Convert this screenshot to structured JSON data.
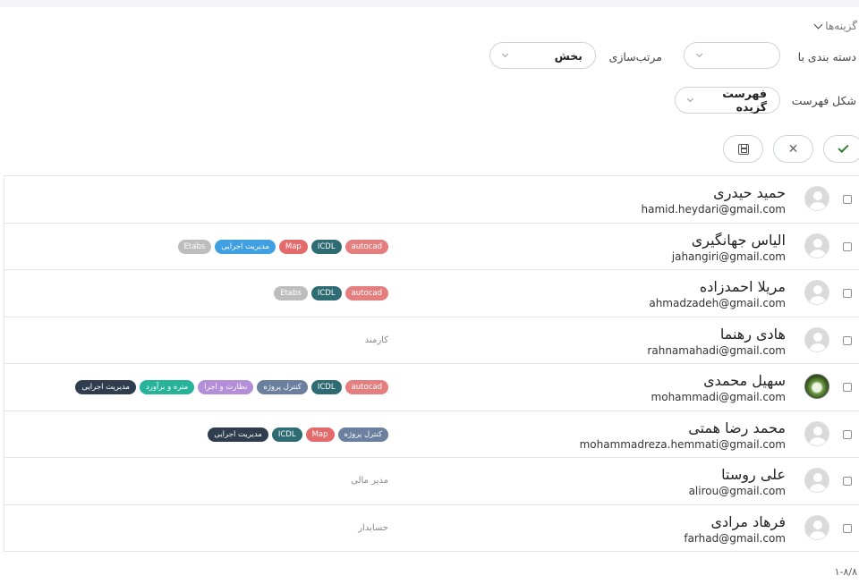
{
  "options": {
    "label": "گزینه‌ها"
  },
  "controls": {
    "group_by": {
      "label": "دسته بندی با",
      "value": ""
    },
    "sort": {
      "label": "مرتب‌سازی",
      "value": "بخش"
    },
    "list_style": {
      "label": "شکل فهرست",
      "value": "فهرست گزیده"
    }
  },
  "actions": {
    "confirm_icon": "check-icon",
    "cancel_icon": "close-icon",
    "save_icon": "save-icon"
  },
  "colors": {
    "autocad": "#e57f7f",
    "ICDL": "#2e6b73",
    "Map": "#e46b6b",
    "project": "#6b7f9e",
    "supervision": "#b48ed8",
    "metering": "#26b39a",
    "executive_dark": "#2f3d4f",
    "executive_blue": "#3f9fe0",
    "Etabs": "#bdbdbd"
  },
  "users": [
    {
      "name": "حمید حیدری",
      "email": "hamid.heydari@gmail.com",
      "photo": false,
      "role": "",
      "tags": []
    },
    {
      "name": "الیاس جهانگیری",
      "email": "jahangiri@gmail.com",
      "photo": false,
      "role": "",
      "tags": [
        {
          "label": "autocad",
          "color": "#e57f7f"
        },
        {
          "label": "ICDL",
          "color": "#2e6b73"
        },
        {
          "label": "Map",
          "color": "#e46b6b"
        },
        {
          "label": "مدیریت اجرایی",
          "color": "#3f9fe0"
        },
        {
          "label": "Etabs",
          "color": "#bdbdbd"
        }
      ]
    },
    {
      "name": "مریلا احمدزاده",
      "email": "ahmadzadeh@gmail.com",
      "photo": false,
      "role": "",
      "tags": [
        {
          "label": "autocad",
          "color": "#e57f7f"
        },
        {
          "label": "ICDL",
          "color": "#2e6b73"
        },
        {
          "label": "Etabs",
          "color": "#bdbdbd"
        }
      ]
    },
    {
      "name": "هادی رهنما",
      "email": "rahnamahadi@gmail.com",
      "photo": false,
      "role": "کارمند",
      "tags": []
    },
    {
      "name": "سهیل محمدی",
      "email": "mohammadi@gmail.com",
      "photo": true,
      "role": "",
      "tags": [
        {
          "label": "autocad",
          "color": "#e57f7f"
        },
        {
          "label": "ICDL",
          "color": "#2e6b73"
        },
        {
          "label": "کنترل پروژه",
          "color": "#6b7f9e"
        },
        {
          "label": "نظارت و اجرا",
          "color": "#b48ed8"
        },
        {
          "label": "متره و برآورد",
          "color": "#26b39a"
        },
        {
          "label": "مدیریت اجرایی",
          "color": "#2f3d4f"
        }
      ]
    },
    {
      "name": "محمد رضا همتی",
      "email": "mohammadreza.hemmati@gmail.com",
      "photo": false,
      "role": "",
      "tags": [
        {
          "label": "کنترل پروژه",
          "color": "#6b7f9e"
        },
        {
          "label": "Map",
          "color": "#e46b6b"
        },
        {
          "label": "ICDL",
          "color": "#2e6b73"
        },
        {
          "label": "مدیریت اجرایی",
          "color": "#2f3d4f"
        }
      ]
    },
    {
      "name": "علی روستا",
      "email": "alirou@gmail.com",
      "photo": false,
      "role": "مدیر مالی",
      "tags": []
    },
    {
      "name": "فرهاد مرادی",
      "email": "farhad@gmail.com",
      "photo": false,
      "role": "حسابدار",
      "tags": []
    }
  ],
  "pager": {
    "text": "۱-۸/۸"
  }
}
